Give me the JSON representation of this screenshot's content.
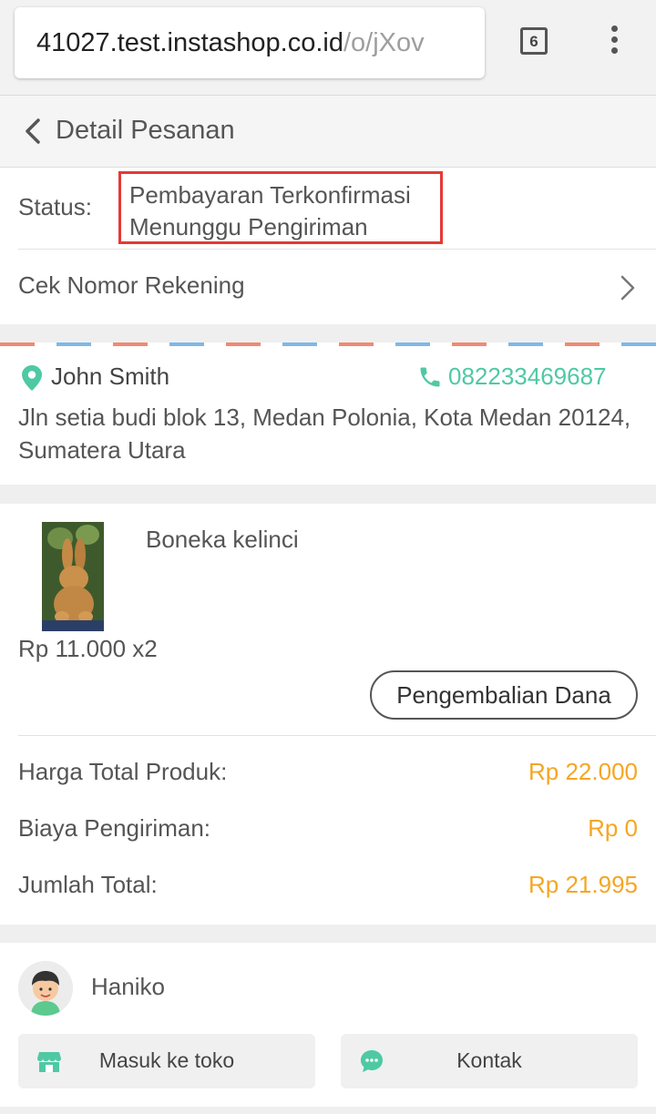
{
  "browser": {
    "url_host": "41027.test.instashop.co.id",
    "url_path": "/o/jXov",
    "tab_count": "6"
  },
  "header": {
    "title": "Detail Pesanan"
  },
  "status": {
    "label": "Status:",
    "line1": "Pembayaran Terkonfirmasi",
    "line2": "Menunggu Pengiriman",
    "highlight_color": "#e53935"
  },
  "account_row": {
    "label": "Cek Nomor Rekening"
  },
  "shipping": {
    "name": "John Smith",
    "phone": "082233469687",
    "address": "Jln setia budi blok 13, Medan Polonia, Kota Medan 20124, Sumatera Utara",
    "accent_color": "#4ec9a4"
  },
  "order": {
    "product_name": "Boneka kelinci",
    "price_qty": "Rp 11.000 x2",
    "refund_label": "Pengembalian Dana",
    "summary": [
      {
        "label": "Harga Total Produk:",
        "value": "Rp 22.000"
      },
      {
        "label": "Biaya Pengiriman:",
        "value": "Rp 0"
      },
      {
        "label": "Jumlah Total:",
        "value": "Rp 21.995"
      }
    ],
    "price_color": "#f5a623"
  },
  "seller": {
    "name": "Haniko",
    "store_button": "Masuk ke toko",
    "contact_button": "Kontak"
  },
  "icons": {
    "tab": "tab-switcher-icon",
    "menu": "kebab-menu-icon",
    "back": "back-arrow-icon",
    "chevron": "chevron-right-icon",
    "pin": "location-pin-icon",
    "phone": "phone-icon",
    "store": "store-icon",
    "chat": "chat-icon"
  }
}
